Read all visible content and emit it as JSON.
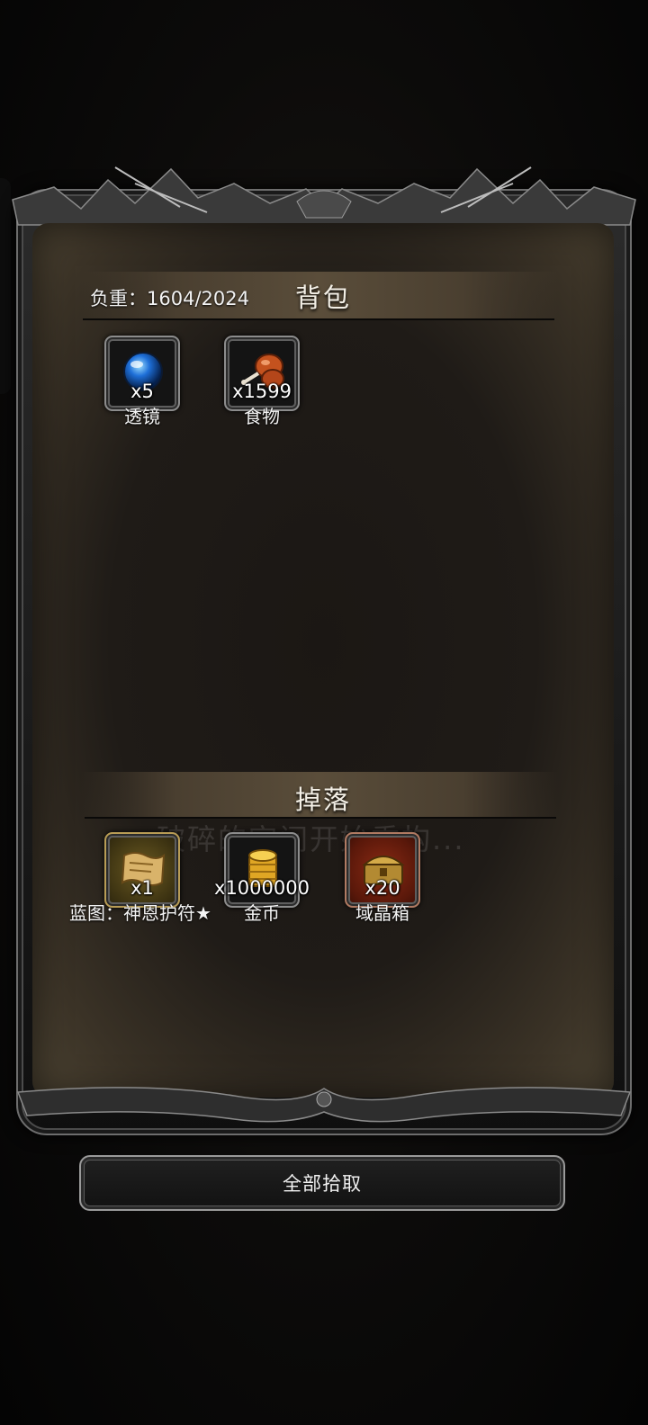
{
  "backpack": {
    "title": "背包",
    "weight": "负重：1604/2024",
    "items": [
      {
        "name": "透镜",
        "count": "x5",
        "icon": "lens-orb-icon"
      },
      {
        "name": "食物",
        "count": "x1599",
        "icon": "meat-drumstick-icon"
      }
    ]
  },
  "drops": {
    "title": "掉落",
    "notice": "破碎的空间开始重构...",
    "items": [
      {
        "name": "蓝图：神恩护符★",
        "count": "x1",
        "icon": "blueprint-scroll-icon"
      },
      {
        "name": "金币",
        "count": "x1000000",
        "icon": "gold-coins-icon"
      },
      {
        "name": "域晶箱",
        "count": "x20",
        "icon": "crystal-chest-icon"
      }
    ]
  },
  "actions": {
    "pick_all": "全部拾取"
  },
  "colors": {
    "panel": "#1f1b17",
    "header_band": "#5a4d3a",
    "frame": "#6d6d6d"
  }
}
